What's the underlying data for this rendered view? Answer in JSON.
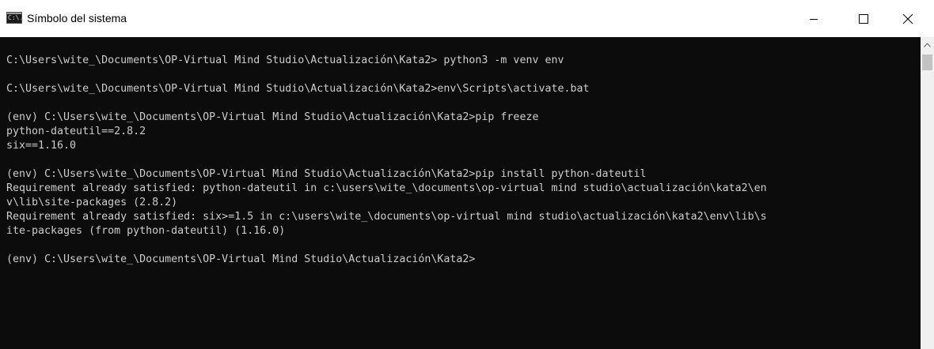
{
  "window": {
    "title": "Símbolo del sistema",
    "icon_text": "C:\\."
  },
  "controls": [
    "minimize",
    "maximize",
    "close"
  ],
  "console": {
    "lines": [
      "C:\\Users\\wite_\\Documents\\OP-Virtual Mind Studio\\Actualización\\Kata2> python3 -m venv env",
      "",
      "C:\\Users\\wite_\\Documents\\OP-Virtual Mind Studio\\Actualización\\Kata2>env\\Scripts\\activate.bat",
      "",
      "(env) C:\\Users\\wite_\\Documents\\OP-Virtual Mind Studio\\Actualización\\Kata2>pip freeze",
      "python-dateutil==2.8.2",
      "six==1.16.0",
      "",
      "(env) C:\\Users\\wite_\\Documents\\OP-Virtual Mind Studio\\Actualización\\Kata2>pip install python-dateutil",
      "Requirement already satisfied: python-dateutil in c:\\users\\wite_\\documents\\op-virtual mind studio\\actualización\\kata2\\en",
      "v\\lib\\site-packages (2.8.2)",
      "Requirement already satisfied: six>=1.5 in c:\\users\\wite_\\documents\\op-virtual mind studio\\actualización\\kata2\\env\\lib\\s",
      "ite-packages (from python-dateutil) (1.16.0)",
      "",
      "(env) C:\\Users\\wite_\\Documents\\OP-Virtual Mind Studio\\Actualización\\Kata2>"
    ]
  },
  "colors": {
    "console_bg": "#0c0c0c",
    "console_text": "#cccccc",
    "titlebar_bg": "#ffffff"
  }
}
